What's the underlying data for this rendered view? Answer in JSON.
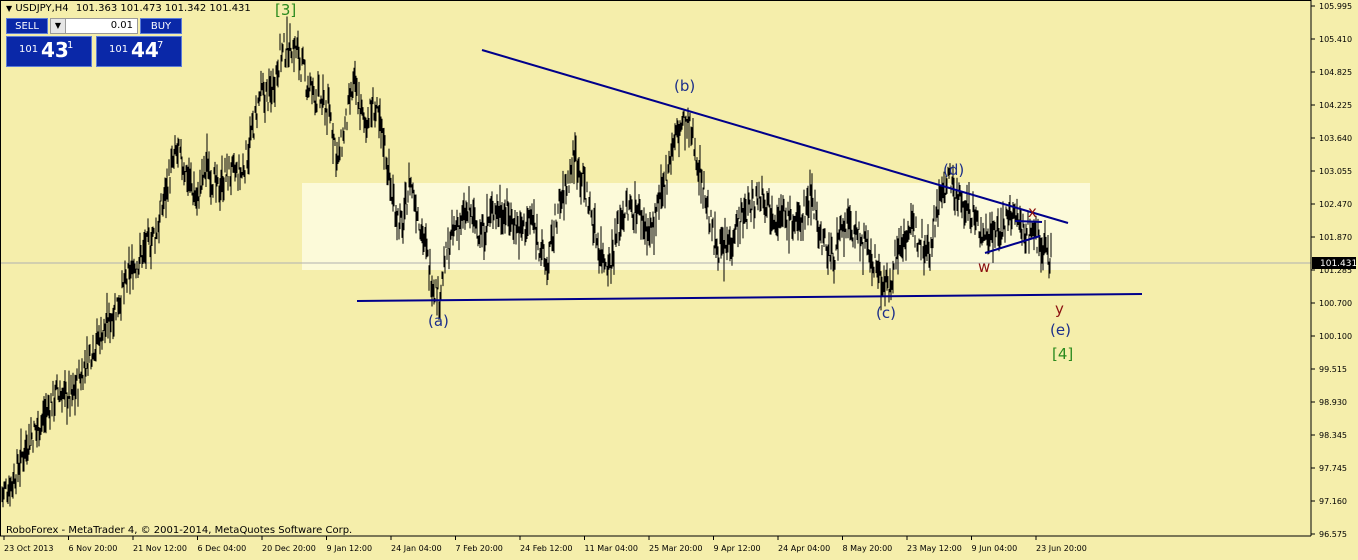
{
  "header": {
    "symbol": "USDJPY,H4",
    "ohlc": "101.363 101.473 101.342 101.431"
  },
  "trade_panel": {
    "sell_label": "SELL",
    "buy_label": "BUY",
    "lot": "0.01",
    "spin_icon": "chevron-down-icon",
    "sell_big": "101",
    "sell_main": "43",
    "sell_sup": "1",
    "buy_big": "101",
    "buy_main": "44",
    "buy_sup": "7"
  },
  "footer": {
    "copyright": "RoboForex - MetaTrader 4, © 2001-2014, MetaQuotes Software Corp."
  },
  "colors": {
    "background": "#f5eeab",
    "candles": "#000000",
    "trendline": "#00008b",
    "box": "#fdfbe0",
    "wave_primary": "#1d2f8a",
    "wave_green": "#2a8a1e",
    "wave_red": "#8b1010",
    "price_tag": "#000000"
  },
  "chart_data": {
    "type": "line",
    "instrument": "USDJPY",
    "timeframe": "H4",
    "current_price": "101.431",
    "y_ticks": [
      "105.995",
      "105.410",
      "104.825",
      "104.225",
      "103.640",
      "103.055",
      "102.470",
      "101.870",
      "101.285",
      "100.700",
      "100.100",
      "99.515",
      "98.930",
      "98.345",
      "97.745",
      "97.160",
      "96.575"
    ],
    "x_ticks": [
      "23 Oct 2013",
      "6 Nov 20:00",
      "21 Nov 12:00",
      "6 Dec 04:00",
      "20 Dec 20:00",
      "9 Jan 12:00",
      "24 Jan 04:00",
      "7 Feb 20:00",
      "24 Feb 12:00",
      "11 Mar 04:00",
      "25 Mar 20:00",
      "9 Apr 12:00",
      "24 Apr 04:00",
      "8 May 20:00",
      "23 May 12:00",
      "9 Jun 04:00",
      "23 Jun 20:00"
    ],
    "ylim": [
      96.575,
      105.995
    ],
    "close_series": [
      [
        0,
        97.3
      ],
      [
        10,
        97.5
      ],
      [
        25,
        98.2
      ],
      [
        40,
        98.6
      ],
      [
        55,
        99.1
      ],
      [
        70,
        99.0
      ],
      [
        90,
        99.9
      ],
      [
        105,
        100.3
      ],
      [
        118,
        100.8
      ],
      [
        130,
        101.3
      ],
      [
        145,
        101.7
      ],
      [
        155,
        102.0
      ],
      [
        165,
        102.8
      ],
      [
        175,
        103.4
      ],
      [
        185,
        103.0
      ],
      [
        195,
        102.5
      ],
      [
        205,
        103.2
      ],
      [
        215,
        102.7
      ],
      [
        225,
        103.0
      ],
      [
        240,
        103.0
      ],
      [
        250,
        103.7
      ],
      [
        258,
        104.4
      ],
      [
        268,
        104.4
      ],
      [
        278,
        105.1
      ],
      [
        288,
        105.3
      ],
      [
        295,
        105.2
      ],
      [
        305,
        104.6
      ],
      [
        318,
        104.3
      ],
      [
        328,
        104.1
      ],
      [
        336,
        103.2
      ],
      [
        345,
        104.0
      ],
      [
        352,
        104.6
      ],
      [
        362,
        103.9
      ],
      [
        372,
        104.2
      ],
      [
        382,
        103.6
      ],
      [
        390,
        102.6
      ],
      [
        400,
        102.0
      ],
      [
        408,
        102.9
      ],
      [
        420,
        102.0
      ],
      [
        430,
        101.1
      ],
      [
        437,
        100.8
      ],
      [
        445,
        101.6
      ],
      [
        455,
        102.1
      ],
      [
        468,
        102.3
      ],
      [
        480,
        101.9
      ],
      [
        492,
        102.4
      ],
      [
        505,
        102.3
      ],
      [
        518,
        102.0
      ],
      [
        530,
        102.2
      ],
      [
        545,
        101.3
      ],
      [
        555,
        102.3
      ],
      [
        565,
        102.8
      ],
      [
        573,
        103.4
      ],
      [
        585,
        102.6
      ],
      [
        598,
        101.6
      ],
      [
        608,
        101.4
      ],
      [
        620,
        102.3
      ],
      [
        635,
        102.4
      ],
      [
        648,
        101.9
      ],
      [
        660,
        102.6
      ],
      [
        670,
        103.5
      ],
      [
        680,
        103.9
      ],
      [
        688,
        103.8
      ],
      [
        700,
        102.9
      ],
      [
        712,
        101.8
      ],
      [
        722,
        101.6
      ],
      [
        735,
        102.1
      ],
      [
        748,
        102.4
      ],
      [
        760,
        102.7
      ],
      [
        772,
        102.3
      ],
      [
        785,
        102.2
      ],
      [
        797,
        102.1
      ],
      [
        810,
        102.7
      ],
      [
        818,
        101.9
      ],
      [
        830,
        101.5
      ],
      [
        845,
        102.1
      ],
      [
        860,
        101.8
      ],
      [
        875,
        101.3
      ],
      [
        886,
        100.9
      ],
      [
        893,
        101.5
      ],
      [
        905,
        102.0
      ],
      [
        918,
        101.9
      ],
      [
        928,
        101.7
      ],
      [
        935,
        102.4
      ],
      [
        946,
        102.9
      ],
      [
        958,
        102.5
      ],
      [
        970,
        102.3
      ],
      [
        980,
        101.9
      ],
      [
        990,
        102.0
      ],
      [
        1000,
        102.0
      ],
      [
        1010,
        102.3
      ],
      [
        1020,
        102.0
      ],
      [
        1030,
        102.0
      ],
      [
        1038,
        101.8
      ],
      [
        1045,
        101.6
      ],
      [
        1050,
        101.43
      ]
    ]
  },
  "annotations": {
    "wave3": "[3]",
    "wave_a": "(a)",
    "wave_b": "(b)",
    "wave_c": "(c)",
    "wave_d": "(d)",
    "wave_e": "(e)",
    "wave4": "[4]",
    "wave_w": "w",
    "wave_x": "x",
    "wave_y": "y"
  }
}
